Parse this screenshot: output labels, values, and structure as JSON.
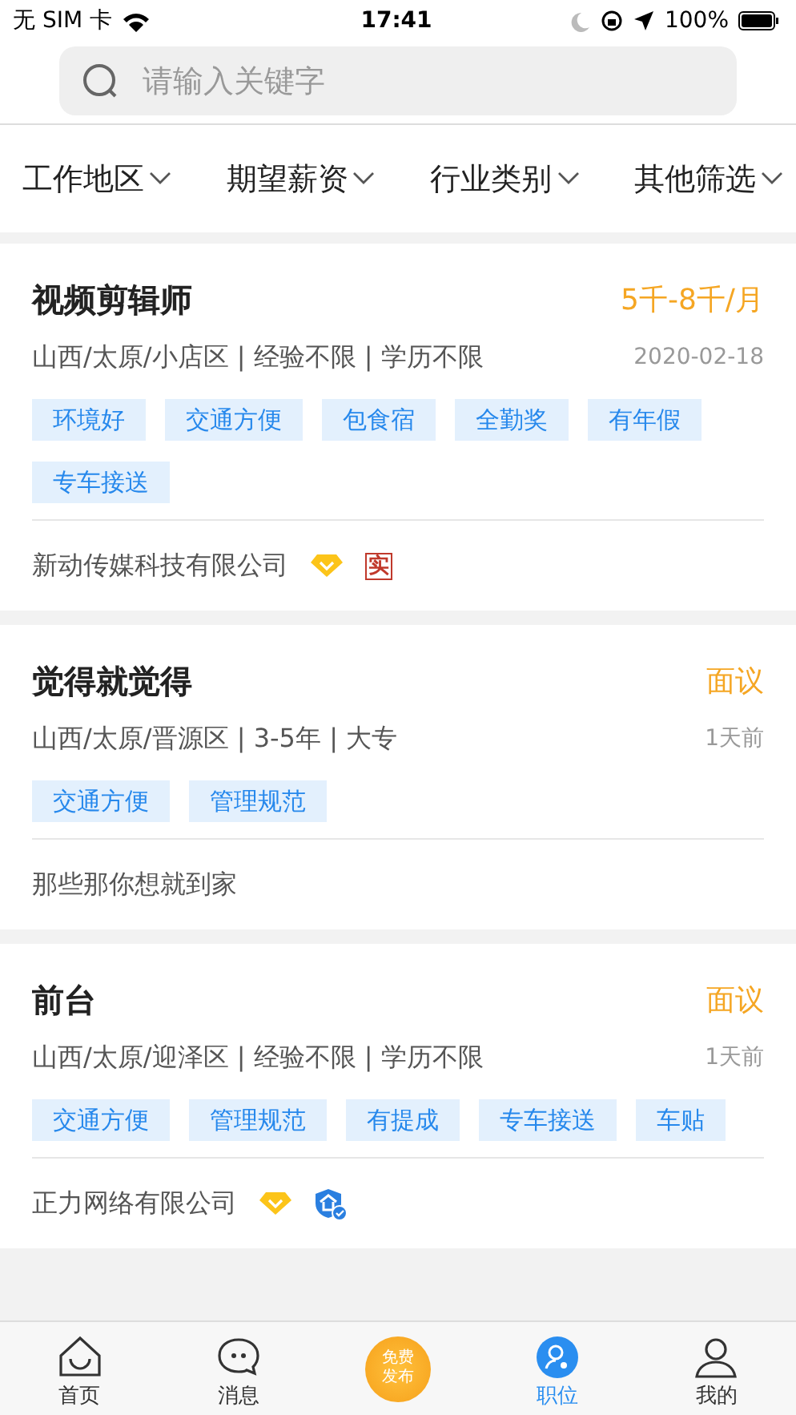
{
  "status_bar": {
    "carrier": "无 SIM 卡",
    "time": "17:41",
    "battery": "100%"
  },
  "search": {
    "placeholder": "请输入关键字"
  },
  "filters": [
    {
      "label": "工作地区"
    },
    {
      "label": "期望薪资"
    },
    {
      "label": "行业类别"
    },
    {
      "label": "其他筛选"
    }
  ],
  "jobs": [
    {
      "title": "视频剪辑师",
      "salary": "5千-8千/月",
      "location": "山西/太原/小店区 | 经验不限 | 学历不限",
      "posted": "2020-02-18",
      "tags": [
        "环境好",
        "交通方便",
        "包食宿",
        "全勤奖",
        "有年假",
        "专车接送"
      ],
      "company": "新动传媒科技有限公司",
      "badges": [
        {
          "kind": "diamond"
        },
        {
          "kind": "seal",
          "text": "实"
        }
      ]
    },
    {
      "title": "觉得就觉得",
      "salary": "面议",
      "location": "山西/太原/晋源区 | 3-5年 | 大专",
      "posted": "1天前",
      "tags": [
        "交通方便",
        "管理规范"
      ],
      "company": "那些那你想就到家"
    },
    {
      "title": "前台",
      "salary": "面议",
      "location": "山西/太原/迎泽区 | 经验不限 | 学历不限",
      "posted": "1天前",
      "tags": [
        "交通方便",
        "管理规范",
        "有提成",
        "专车接送",
        "车贴"
      ],
      "company": "正力网络有限公司",
      "badges": [
        {
          "kind": "diamond"
        },
        {
          "kind": "verified"
        }
      ]
    }
  ],
  "tab_bar": [
    {
      "kind": "home",
      "label": "首页",
      "selected": false
    },
    {
      "kind": "chat",
      "label": "消息",
      "selected": false
    },
    {
      "kind": "publish",
      "label": "免费发布"
    },
    {
      "kind": "jobs",
      "label": "职位",
      "selected": true
    },
    {
      "kind": "profile",
      "label": "我的",
      "selected": false
    }
  ]
}
